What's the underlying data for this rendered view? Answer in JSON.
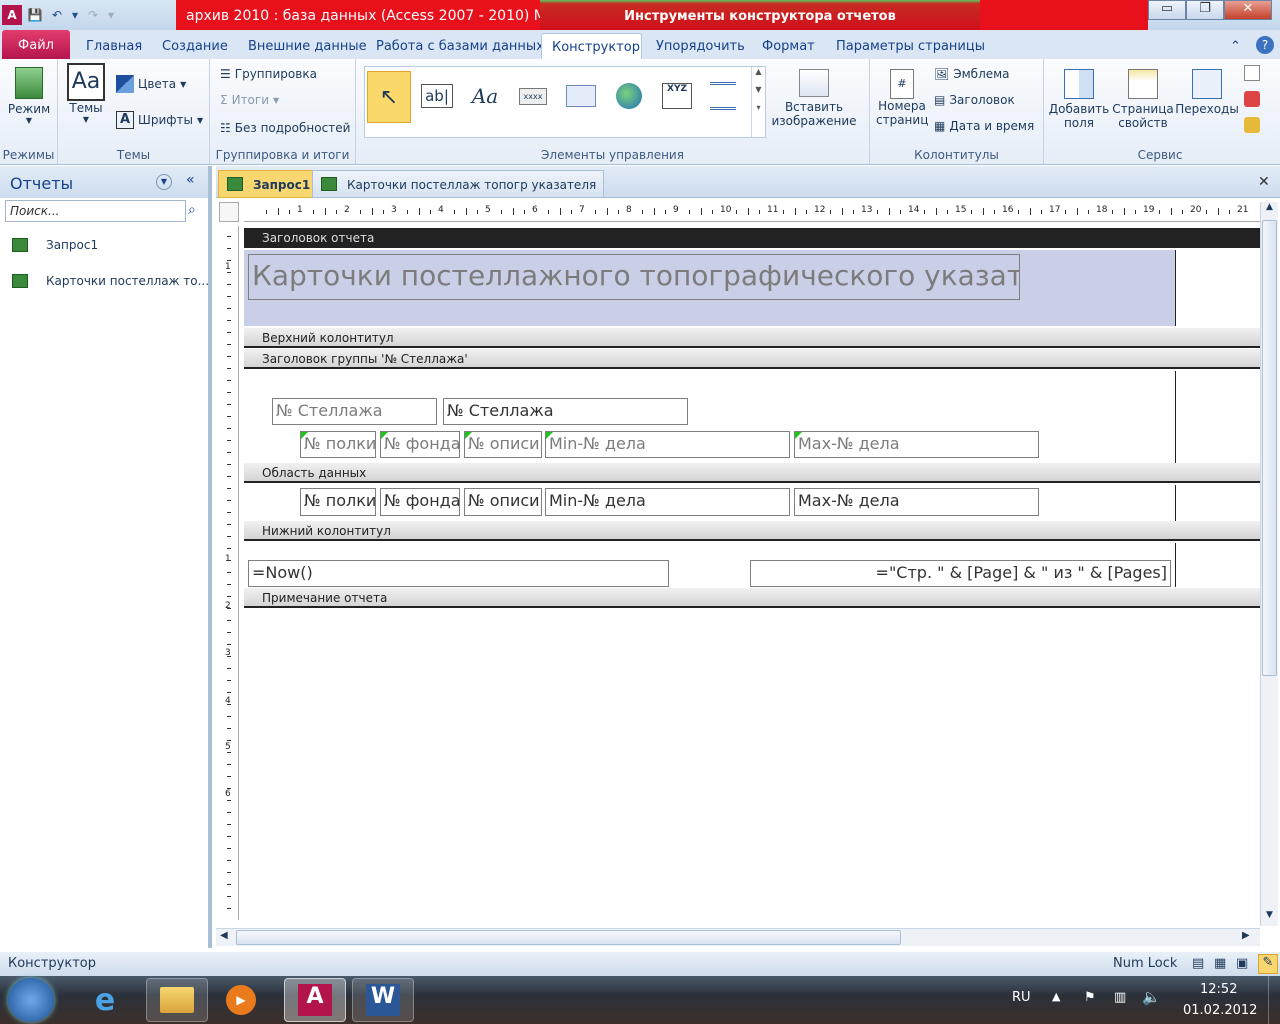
{
  "window": {
    "title": "архив 2010 : база данных (Access 2007 - 2010) M...",
    "context_tools": "Инструменты конструктора отчетов",
    "minimize": "▭",
    "maximize": "❐",
    "close": "✕"
  },
  "qat": [
    "A",
    "💾",
    "↶",
    "▾",
    "↷",
    "▾"
  ],
  "ribbon_tabs": {
    "file": "Файл",
    "tabs": [
      "Главная",
      "Создание",
      "Внешние данные",
      "Работа с базами данных",
      "Конструктор",
      "Упорядочить",
      "Формат",
      "Параметры страницы"
    ],
    "active": "Конструктор",
    "help": "?"
  },
  "ribbon": {
    "modes": {
      "button": "Режим",
      "group": "Режимы"
    },
    "themes": {
      "button": "Темы",
      "colors": "Цвета",
      "fonts": "Шрифты",
      "group": "Темы"
    },
    "grouping": {
      "group_by": "Группировка",
      "totals": "Итоги",
      "hide_details": "Без подробностей",
      "group": "Группировка и итоги"
    },
    "controls": {
      "group": "Элементы управления",
      "insert_image_1": "Вставить",
      "insert_image_2": "изображение"
    },
    "headers": {
      "page_numbers_1": "Номера",
      "page_numbers_2": "страниц",
      "logo": "Эмблема",
      "title": "Заголовок",
      "date_time": "Дата и время",
      "group": "Колонтитулы"
    },
    "tools": {
      "add_fields_1": "Добавить",
      "add_fields_2": "поля",
      "property_sheet_1": "Страница",
      "property_sheet_2": "свойств",
      "tab_order": "Переходы",
      "group": "Сервис"
    }
  },
  "nav": {
    "title": "Отчеты",
    "search_placeholder": "Поиск...",
    "items": [
      "Запрос1",
      "Карточки постеллаж то..."
    ]
  },
  "doc_tabs": [
    "Запрос1",
    "Карточки постеллаж топогр указателя"
  ],
  "ruler_numbers": [
    "1",
    "2",
    "3",
    "4",
    "5",
    "6",
    "7",
    "8",
    "9",
    "10",
    "11",
    "12",
    "13",
    "14",
    "15",
    "16",
    "17",
    "18",
    "19",
    "20",
    "21"
  ],
  "vruler_numbers": [
    "1",
    "1",
    "2",
    "3",
    "4",
    "5",
    "6"
  ],
  "report": {
    "sections": {
      "report_header": "Заголовок отчета",
      "page_header": "Верхний колонтитул",
      "group_header": "Заголовок группы '№ Стеллажа'",
      "detail": "Область данных",
      "page_footer": "Нижний колонтитул",
      "report_footer": "Примечание отчета"
    },
    "title_label": "Карточки постеллажного топографического указателя",
    "group_label": "№ Стеллажа",
    "group_field": "№ Стеллажа",
    "col_labels": [
      "№ полки",
      "№ фонда",
      "№ описи",
      "Min-№ дела",
      "Max-№ дела"
    ],
    "col_fields": [
      "№ полки",
      "№ фонда",
      "№ описи",
      "Min-№ дела",
      "Max-№ дела"
    ],
    "footer_now": "=Now()",
    "footer_pages": "=\"Стр. \" & [Page] & \" из \" & [Pages]"
  },
  "status": {
    "left": "Конструктор",
    "numlock": "Num Lock"
  },
  "taskbar": {
    "lang": "RU",
    "time": "12:52",
    "date": "01.02.2012"
  }
}
